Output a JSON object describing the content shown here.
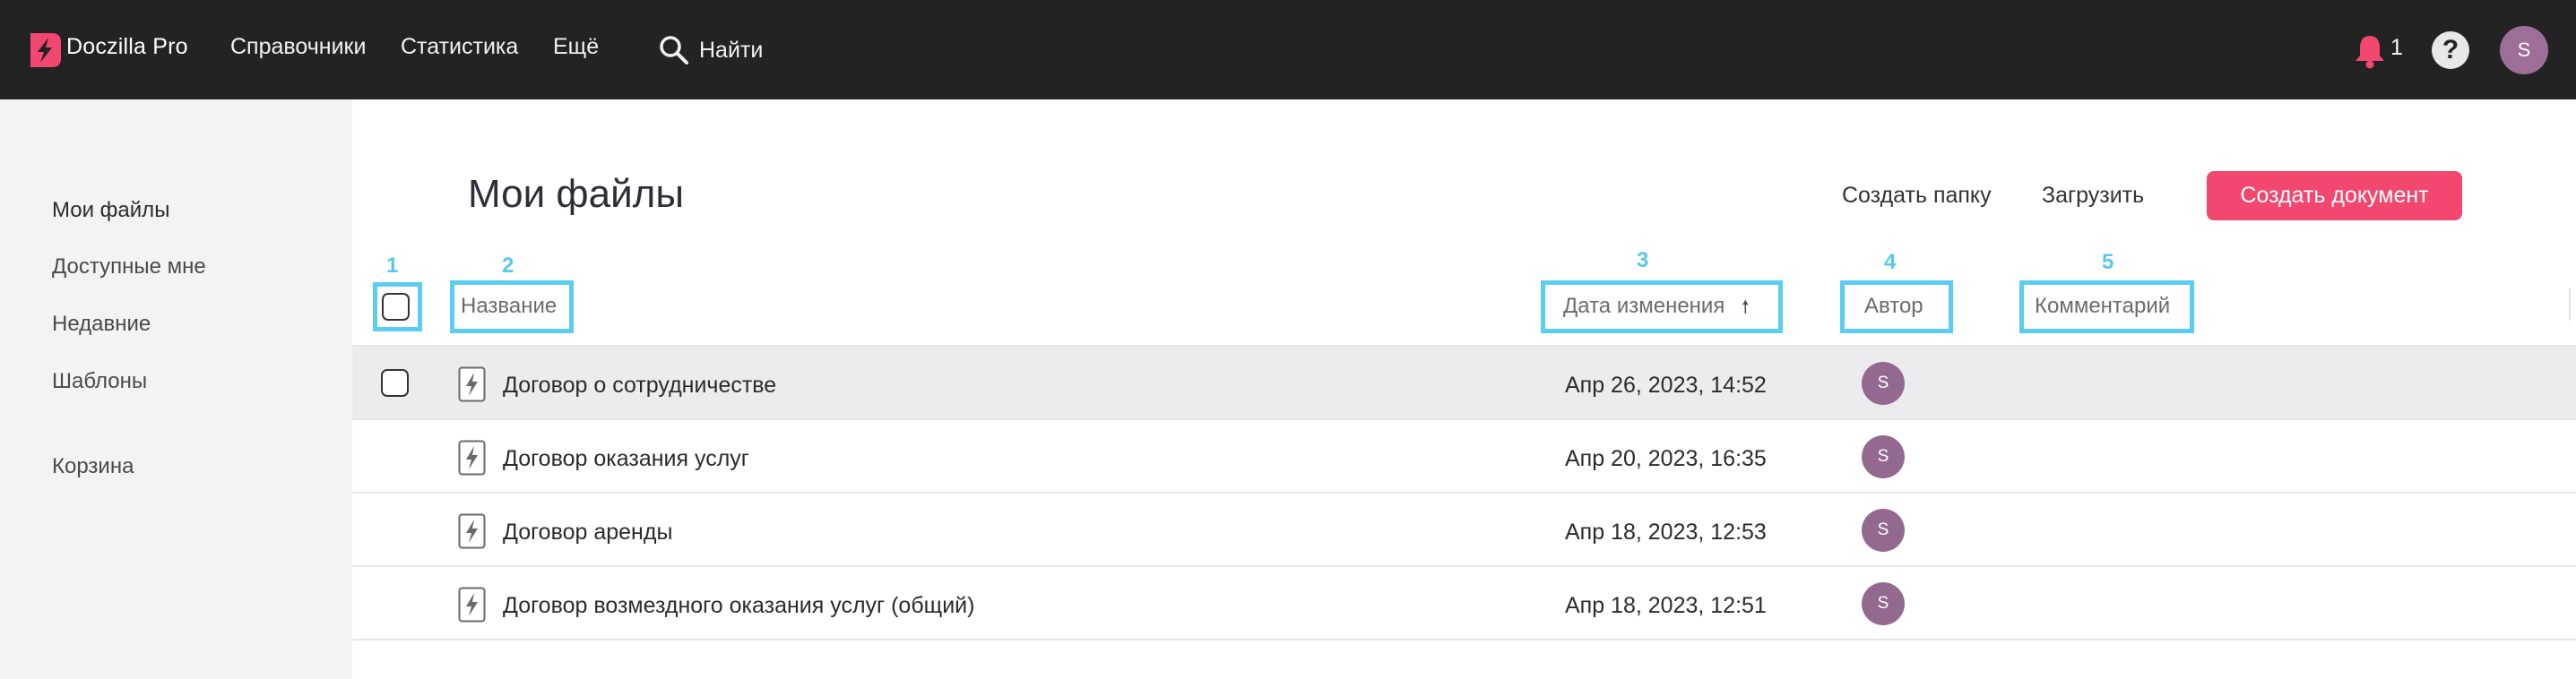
{
  "header": {
    "brand": "Doczilla Pro",
    "nav": [
      "Справочники",
      "Статистика",
      "Ещё"
    ],
    "search_label": "Найти",
    "notification_count": "1",
    "help_label": "?",
    "user_initial": "S"
  },
  "sidebar": {
    "items": [
      {
        "label": "Мои файлы",
        "active": true
      },
      {
        "label": "Доступные мне",
        "active": false
      },
      {
        "label": "Недавние",
        "active": false
      },
      {
        "label": "Шаблоны",
        "active": false
      },
      {
        "label": "Корзина",
        "active": false
      }
    ]
  },
  "main": {
    "title": "Мои файлы",
    "create_folder": "Создать папку",
    "upload": "Загрузить",
    "create_document": "Создать документ"
  },
  "annotations": [
    "1",
    "2",
    "3",
    "4",
    "5"
  ],
  "table": {
    "columns": {
      "name": "Название",
      "modified": "Дата изменения",
      "sort_arrow": "🠕",
      "author": "Автор",
      "comment": "Комментарий"
    },
    "rows": [
      {
        "name": "Договор о сотрудничестве",
        "modified": "Апр 26, 2023, 14:52",
        "author": "S"
      },
      {
        "name": "Договор оказания услуг",
        "modified": "Апр 20, 2023, 16:35",
        "author": "S"
      },
      {
        "name": "Договор аренды",
        "modified": "Апр 18, 2023, 12:53",
        "author": "S"
      },
      {
        "name": "Договор возмездного оказания услуг (общий)",
        "modified": "Апр 18, 2023, 12:51",
        "author": "S"
      }
    ]
  },
  "colors": {
    "topbar": "#232323",
    "accent": "#f2486f",
    "annotation": "#5bcdf0",
    "avatar": "#93698f"
  }
}
